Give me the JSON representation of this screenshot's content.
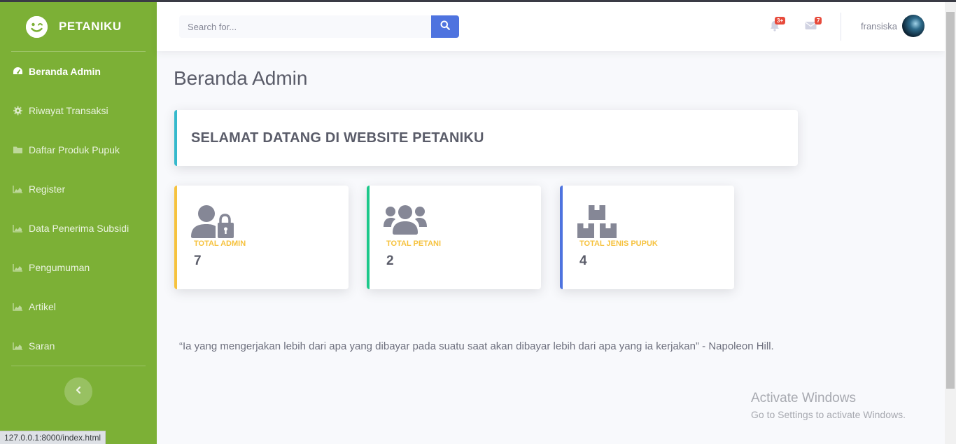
{
  "brand": {
    "name": "PETANIKU",
    "logo_icon": "smile-wink-icon"
  },
  "sidebar": {
    "items": [
      {
        "label": "Beranda Admin",
        "icon": "tachometer-icon",
        "active": true
      },
      {
        "label": "Riwayat Transaksi",
        "icon": "cog-icon"
      },
      {
        "label": "Daftar Produk Pupuk",
        "icon": "folder-icon"
      },
      {
        "label": "Register",
        "icon": "chart-area-icon"
      },
      {
        "label": "Data Penerima Subsidi",
        "icon": "chart-area-icon"
      },
      {
        "label": "Pengumuman",
        "icon": "chart-area-icon"
      },
      {
        "label": "Artikel",
        "icon": "chart-area-icon"
      },
      {
        "label": "Saran",
        "icon": "chart-area-icon"
      }
    ],
    "toggle_icon": "chevron-left-icon"
  },
  "topbar": {
    "search_placeholder": "Search for...",
    "alerts_badge": "3+",
    "messages_badge": "7",
    "username": "fransiska"
  },
  "page": {
    "title": "Beranda Admin",
    "welcome": "SELAMAT DATANG DI WEBSITE PETANIKU",
    "cards": [
      {
        "label": "TOTAL ADMIN",
        "value": "7",
        "icon": "user-lock-icon",
        "accent": "#f6c23e"
      },
      {
        "label": "TOTAL PETANI",
        "value": "2",
        "icon": "users-icon",
        "accent": "#1cc88a"
      },
      {
        "label": "TOTAL JENIS PUPUK",
        "value": "4",
        "icon": "boxes-icon",
        "accent": "#4e73df"
      }
    ],
    "quote": "“Ia yang mengerjakan lebih dari apa yang dibayar pada suatu saat akan dibayar lebih dari apa yang ia kerjakan” - Napoleon Hill."
  },
  "status_url": "127.0.0.1:8000/index.html",
  "watermark": {
    "title": "Activate Windows",
    "subtitle": "Go to Settings to activate Windows."
  },
  "colors": {
    "sidebar": "#7cb036",
    "primary": "#4e73df",
    "info": "#36b9cc",
    "warning": "#f6c23e",
    "success": "#1cc88a"
  }
}
